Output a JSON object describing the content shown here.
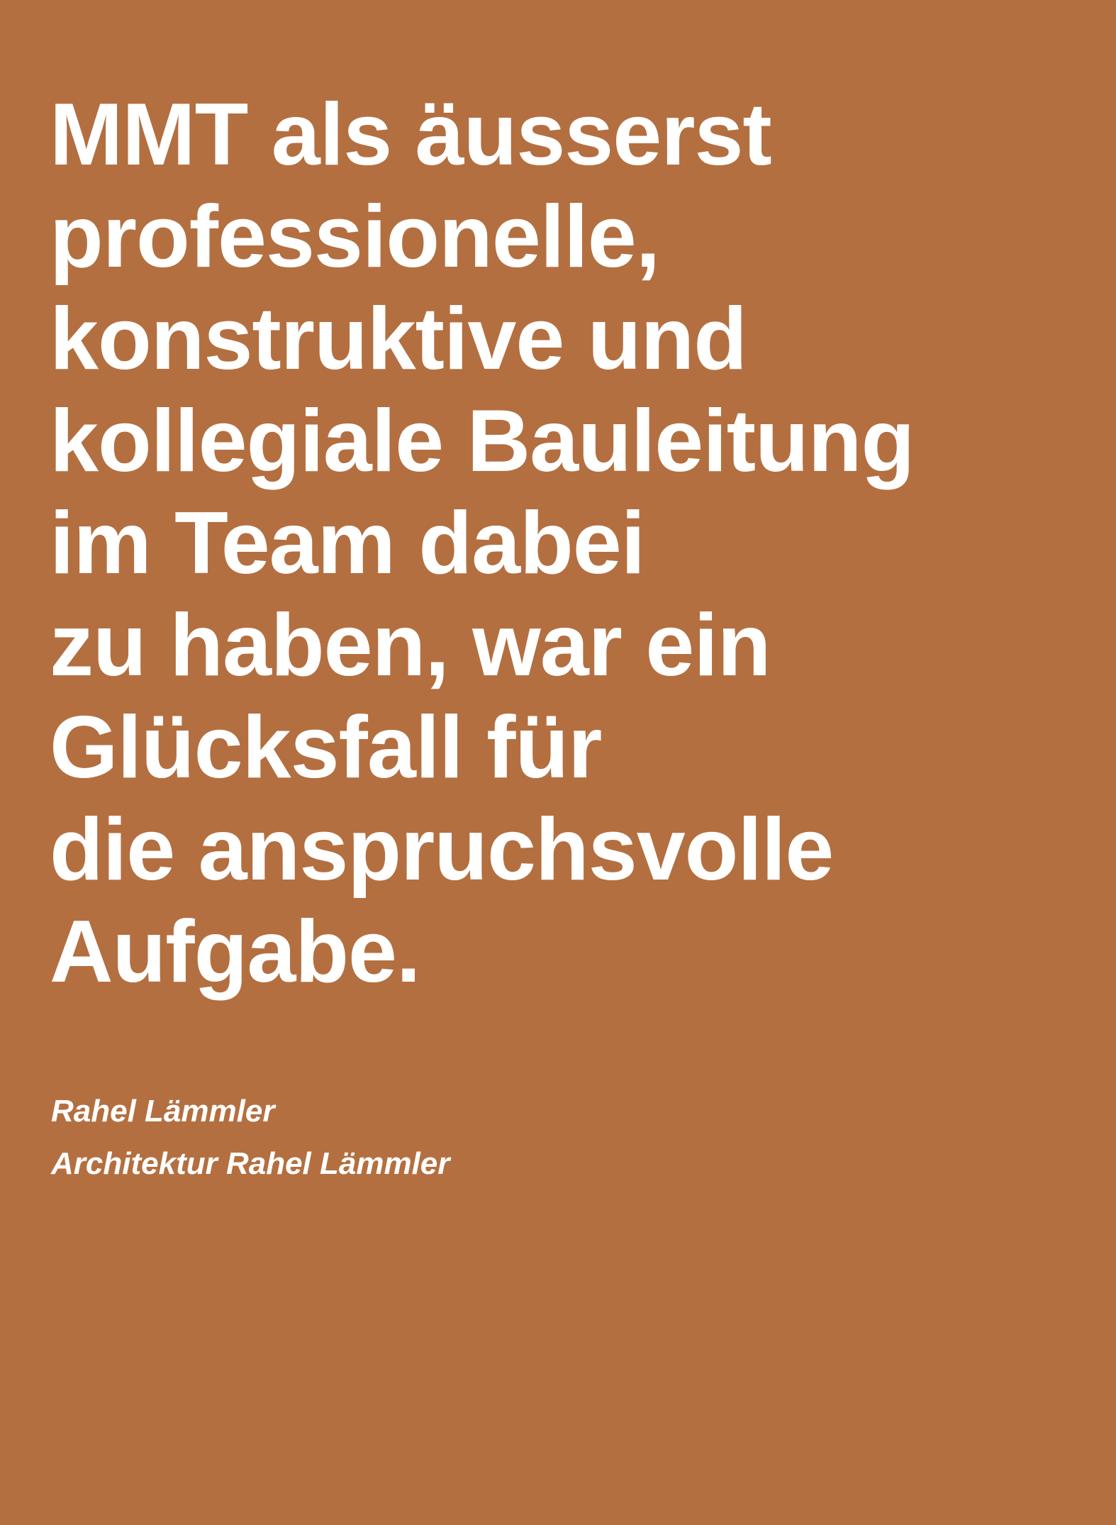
{
  "colors": {
    "background": "#b46f40",
    "text": "#ffffff"
  },
  "quote": {
    "lines": [
      "MMT als äusserst",
      "professionelle,",
      "konstruktive und",
      "kollegiale Bauleitung",
      "im Team dabei",
      "zu haben, war ein",
      "Glücksfall für",
      "die anspruchsvolle",
      "Aufgabe."
    ]
  },
  "attribution": {
    "name": "Rahel Lämmler",
    "organization": "Architektur Rahel Lämmler"
  }
}
